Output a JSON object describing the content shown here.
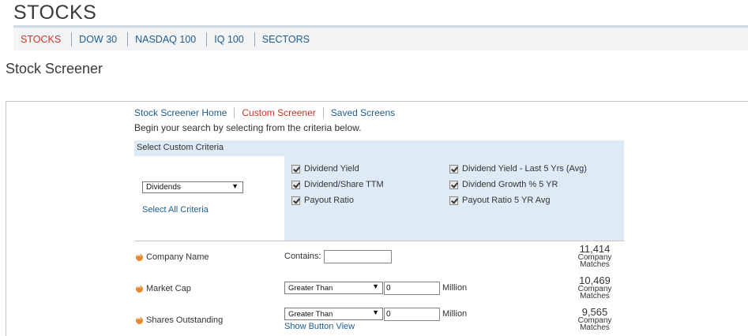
{
  "header": {
    "title": "STOCKS"
  },
  "nav": {
    "items": [
      {
        "label": "STOCKS",
        "active": true
      },
      {
        "label": "DOW 30",
        "active": false
      },
      {
        "label": "NASDAQ 100",
        "active": false
      },
      {
        "label": "IQ 100",
        "active": false
      },
      {
        "label": "SECTORS",
        "active": false
      }
    ]
  },
  "page": {
    "section_title": "Stock Screener"
  },
  "screener": {
    "links": [
      {
        "label": "Stock Screener Home",
        "active": false
      },
      {
        "label": "Custom Screener",
        "active": true
      },
      {
        "label": "Saved Screens",
        "active": false
      }
    ],
    "intro": "Begin your search by selecting from the criteria below.",
    "criteria_header": "Select Custom Criteria",
    "category_selected": "Dividends",
    "select_all_label": "Select All Criteria",
    "criteria": [
      {
        "label": "Dividend Yield",
        "checked": true
      },
      {
        "label": "Dividend/Share TTM",
        "checked": true
      },
      {
        "label": "Payout Ratio",
        "checked": true
      },
      {
        "label": "Dividend Yield - Last 5 Yrs (Avg)",
        "checked": true
      },
      {
        "label": "Dividend Growth % 5 YR",
        "checked": true
      },
      {
        "label": "Payout Ratio 5 YR Avg",
        "checked": true
      }
    ],
    "rows": [
      {
        "label": "Company Name",
        "contains_label": "Contains:",
        "contains_value": "",
        "matches": "11,414"
      },
      {
        "label": "Market Cap",
        "operator": "Greater Than",
        "value": "0",
        "unit": "Million",
        "matches": "10,469"
      },
      {
        "label": "Shares Outstanding",
        "operator": "Greater Than",
        "value": "0",
        "unit": "Million",
        "matches": "9,565"
      }
    ],
    "show_button_view": "Show Button View",
    "matches_label_line1": "Company",
    "matches_label_line2": "Matches",
    "colors": {
      "link": "#1f5d8e",
      "active": "#c9352b",
      "panel": "#deeaf5",
      "remove_icon": "#e8892b"
    }
  }
}
